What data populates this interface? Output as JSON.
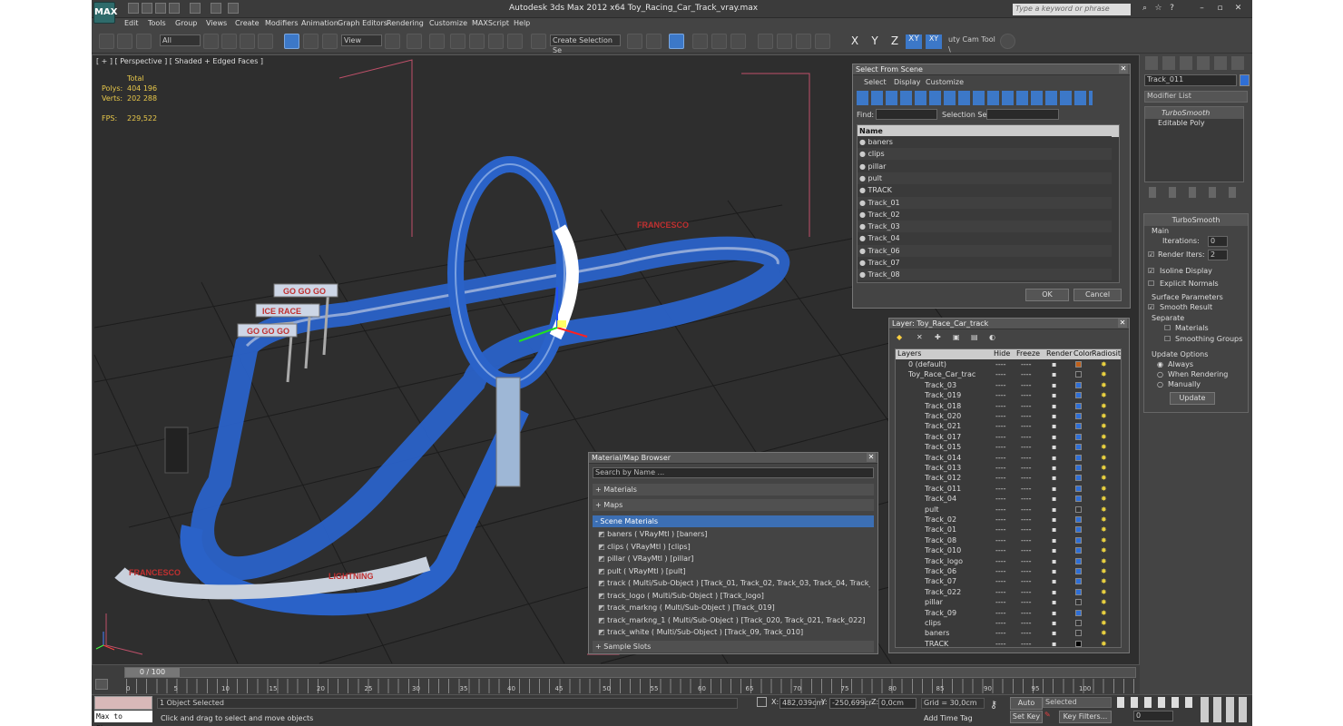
{
  "window": {
    "title": "Autodesk 3ds Max  2012 x64     Toy_Racing_Car_Track_vray.max",
    "search_placeholder": "Type a keyword or phrase",
    "logo": "MAX"
  },
  "menu": [
    "Edit",
    "Tools",
    "Group",
    "Views",
    "Create",
    "Modifiers",
    "Animation",
    "Graph Editors",
    "Rendering",
    "Customize",
    "MAXScript",
    "Help"
  ],
  "toolbar": {
    "filter": "All",
    "ref_coord": "View",
    "selection_set": "Create Selection Se",
    "axes": [
      "X",
      "Y",
      "Z",
      "XY",
      "XY"
    ],
    "cam_tool": "uty Cam Tool \\"
  },
  "viewport": {
    "label": "[ + ] [ Perspective ] [ Shaded + Edged Faces ]",
    "stats_header": "Total",
    "polys_label": "Polys:",
    "polys": "404 196",
    "verts_label": "Verts:",
    "verts": "202 288",
    "fps_label": "FPS:",
    "fps": "229,522",
    "banner_texts": [
      "GO GO GO",
      "ICE RACE",
      "GO GO GO",
      "FRANCESCO",
      "FRANCESCO",
      "LIGHTNING"
    ]
  },
  "select_from_scene": {
    "title": "Select From Scene",
    "menus": [
      "Select",
      "Display",
      "Customize"
    ],
    "find_label": "Find:",
    "selset_label": "Selection Set:",
    "col_name": "Name",
    "items": [
      "baners",
      "clips",
      "pillar",
      "pult",
      "TRACK",
      "Track_01",
      "Track_02",
      "Track_03",
      "Track_04",
      "Track_06",
      "Track_07",
      "Track_08"
    ],
    "ok": "OK",
    "cancel": "Cancel"
  },
  "layer_panel": {
    "title": "Layer: Toy_Race_Car_track",
    "columns": [
      "Layers",
      "Hide",
      "Freeze",
      "Render",
      "Color",
      "Radiosity"
    ],
    "layers": [
      {
        "name": "0 (default)",
        "color": "#c0601a",
        "indent": 0
      },
      {
        "name": "Toy_Race_Car_trac",
        "color": "#333333",
        "indent": 0
      },
      {
        "name": "Track_03",
        "color": "#2f6fd6",
        "indent": 1
      },
      {
        "name": "Track_019",
        "color": "#2f6fd6",
        "indent": 1
      },
      {
        "name": "Track_018",
        "color": "#2f6fd6",
        "indent": 1
      },
      {
        "name": "Track_020",
        "color": "#2f6fd6",
        "indent": 1
      },
      {
        "name": "Track_021",
        "color": "#2f6fd6",
        "indent": 1
      },
      {
        "name": "Track_017",
        "color": "#2f6fd6",
        "indent": 1
      },
      {
        "name": "Track_015",
        "color": "#2f6fd6",
        "indent": 1
      },
      {
        "name": "Track_014",
        "color": "#2f6fd6",
        "indent": 1
      },
      {
        "name": "Track_013",
        "color": "#2f6fd6",
        "indent": 1
      },
      {
        "name": "Track_012",
        "color": "#2f6fd6",
        "indent": 1
      },
      {
        "name": "Track_011",
        "color": "#2f6fd6",
        "indent": 1
      },
      {
        "name": "Track_04",
        "color": "#2f6fd6",
        "indent": 1
      },
      {
        "name": "pult",
        "color": "#333333",
        "indent": 1
      },
      {
        "name": "Track_02",
        "color": "#2f6fd6",
        "indent": 1
      },
      {
        "name": "Track_01",
        "color": "#2f6fd6",
        "indent": 1
      },
      {
        "name": "Track_08",
        "color": "#2f6fd6",
        "indent": 1
      },
      {
        "name": "Track_010",
        "color": "#2f6fd6",
        "indent": 1
      },
      {
        "name": "Track_logo",
        "color": "#2f6fd6",
        "indent": 1
      },
      {
        "name": "Track_06",
        "color": "#2f6fd6",
        "indent": 1
      },
      {
        "name": "Track_07",
        "color": "#2f6fd6",
        "indent": 1
      },
      {
        "name": "Track_022",
        "color": "#2f6fd6",
        "indent": 1
      },
      {
        "name": "pillar",
        "color": "#333333",
        "indent": 1
      },
      {
        "name": "Track_09",
        "color": "#2f6fd6",
        "indent": 1
      },
      {
        "name": "clips",
        "color": "#333333",
        "indent": 1
      },
      {
        "name": "baners",
        "color": "#333333",
        "indent": 1
      },
      {
        "name": "TRACK",
        "color": "#000000",
        "indent": 1
      }
    ],
    "cell_dash": "----"
  },
  "material_browser": {
    "title": "Material/Map Browser",
    "search_placeholder": "Search by Name ...",
    "sections": {
      "materials": "+ Materials",
      "maps": "+ Maps",
      "scene": "- Scene Materials",
      "samples": "+ Sample Slots"
    },
    "items": [
      "baners  ( VRayMtl ) [baners]",
      "clips  ( VRayMtl ) [clips]",
      "pillar  ( VRayMtl ) [pillar]",
      "pult  ( VRayMtl ) [pult]",
      "track  ( Multi/Sub-Object )  [Track_01, Track_02, Track_03, Track_04, Track_06,..",
      "track_logo  ( Multi/Sub-Object ) [Track_logo]",
      "track_markng  ( Multi/Sub-Object ) [Track_019]",
      "track_markng_1  ( Multi/Sub-Object ) [Track_020, Track_021, Track_022]",
      "track_white  ( Multi/Sub-Object ) [Track_09, Track_010]"
    ]
  },
  "command_panel": {
    "object_name": "Track_011",
    "modifier_list": "Modifier List",
    "stack": [
      "TurboSmooth",
      "Editable Poly"
    ],
    "rollout_title": "TurboSmooth",
    "main": "Main",
    "iterations_label": "Iterations:",
    "iterations": "0",
    "render_iters_label": "Render Iters:",
    "render_iters": "2",
    "isoline": "Isoline Display",
    "explicit": "Explicit Normals",
    "surface": "Surface Parameters",
    "smooth": "Smooth Result",
    "separate": "Separate",
    "materials": "Materials",
    "smoothing": "Smoothing Groups",
    "update_options": "Update Options",
    "always": "Always",
    "when_rendering": "When Rendering",
    "manually": "Manually",
    "update_btn": "Update"
  },
  "timeline": {
    "frame": "0 / 100",
    "ticks": [
      "0",
      "5",
      "10",
      "15",
      "20",
      "25",
      "30",
      "35",
      "40",
      "45",
      "50",
      "55",
      "60",
      "65",
      "70",
      "75",
      "80",
      "85",
      "90",
      "95",
      "100"
    ]
  },
  "status": {
    "script": "Max to Physc.",
    "selected": "1 Object Selected",
    "prompt": "Click and drag to select and move objects",
    "x_label": "X:",
    "x": "482,039cm",
    "y_label": "Y:",
    "y": "-250,699cr",
    "z_label": "Z:",
    "z": "0,0cm",
    "grid": "Grid = 30,0cm",
    "add_time_tag": "Add Time Tag",
    "auto_key": "Auto Key",
    "set_key": "Set Key",
    "key_mode": "Selected",
    "key_filters": "Key Filters...",
    "frame": "0"
  }
}
